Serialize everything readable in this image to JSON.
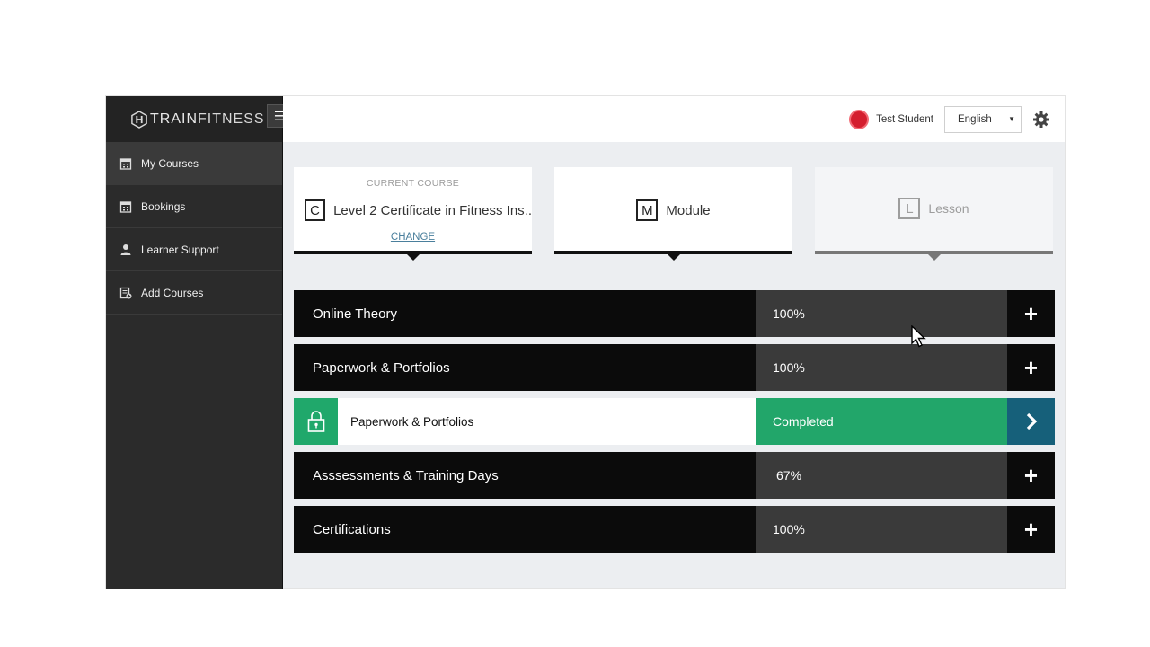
{
  "app": {
    "brand": {
      "prefix": "TRAIN",
      "suffix": "FITNESS"
    },
    "menu_toggle_icon": "menu-icon"
  },
  "sidebar": {
    "items": [
      {
        "label": "My Courses",
        "icon": "calendar-icon",
        "active": true
      },
      {
        "label": "Bookings",
        "icon": "calendar-icon",
        "active": false
      },
      {
        "label": "Learner Support",
        "icon": "person-icon",
        "active": false
      },
      {
        "label": "Add Courses",
        "icon": "add-document-icon",
        "active": false
      }
    ]
  },
  "header": {
    "user_name": "Test Student",
    "language": "English",
    "settings_icon": "gear-icon",
    "avatar_color": "#d41e2e"
  },
  "cards": {
    "course": {
      "label": "CURRENT COURSE",
      "letter": "C",
      "title": "Level 2 Certificate in Fitness Ins..",
      "change_label": "CHANGE"
    },
    "module": {
      "letter": "M",
      "title": "Module"
    },
    "lesson": {
      "letter": "L",
      "title": "Lesson"
    }
  },
  "rows": [
    {
      "name": "Online Theory",
      "progress": "100%"
    },
    {
      "name": "Paperwork & Portfolios",
      "progress": "100%"
    },
    {
      "name": "Paperwork & Portfolios",
      "progress": "Completed",
      "sub": true,
      "icon": "lock-icon",
      "action_icon": "chevron-right-icon"
    },
    {
      "name": "Asssessments & Training Days",
      "progress": "67%"
    },
    {
      "name": "Certifications",
      "progress": "100%"
    }
  ],
  "colors": {
    "accent_green": "#22a66a",
    "accent_teal": "#16607a",
    "sidebar_bg": "#2b2b2b"
  }
}
